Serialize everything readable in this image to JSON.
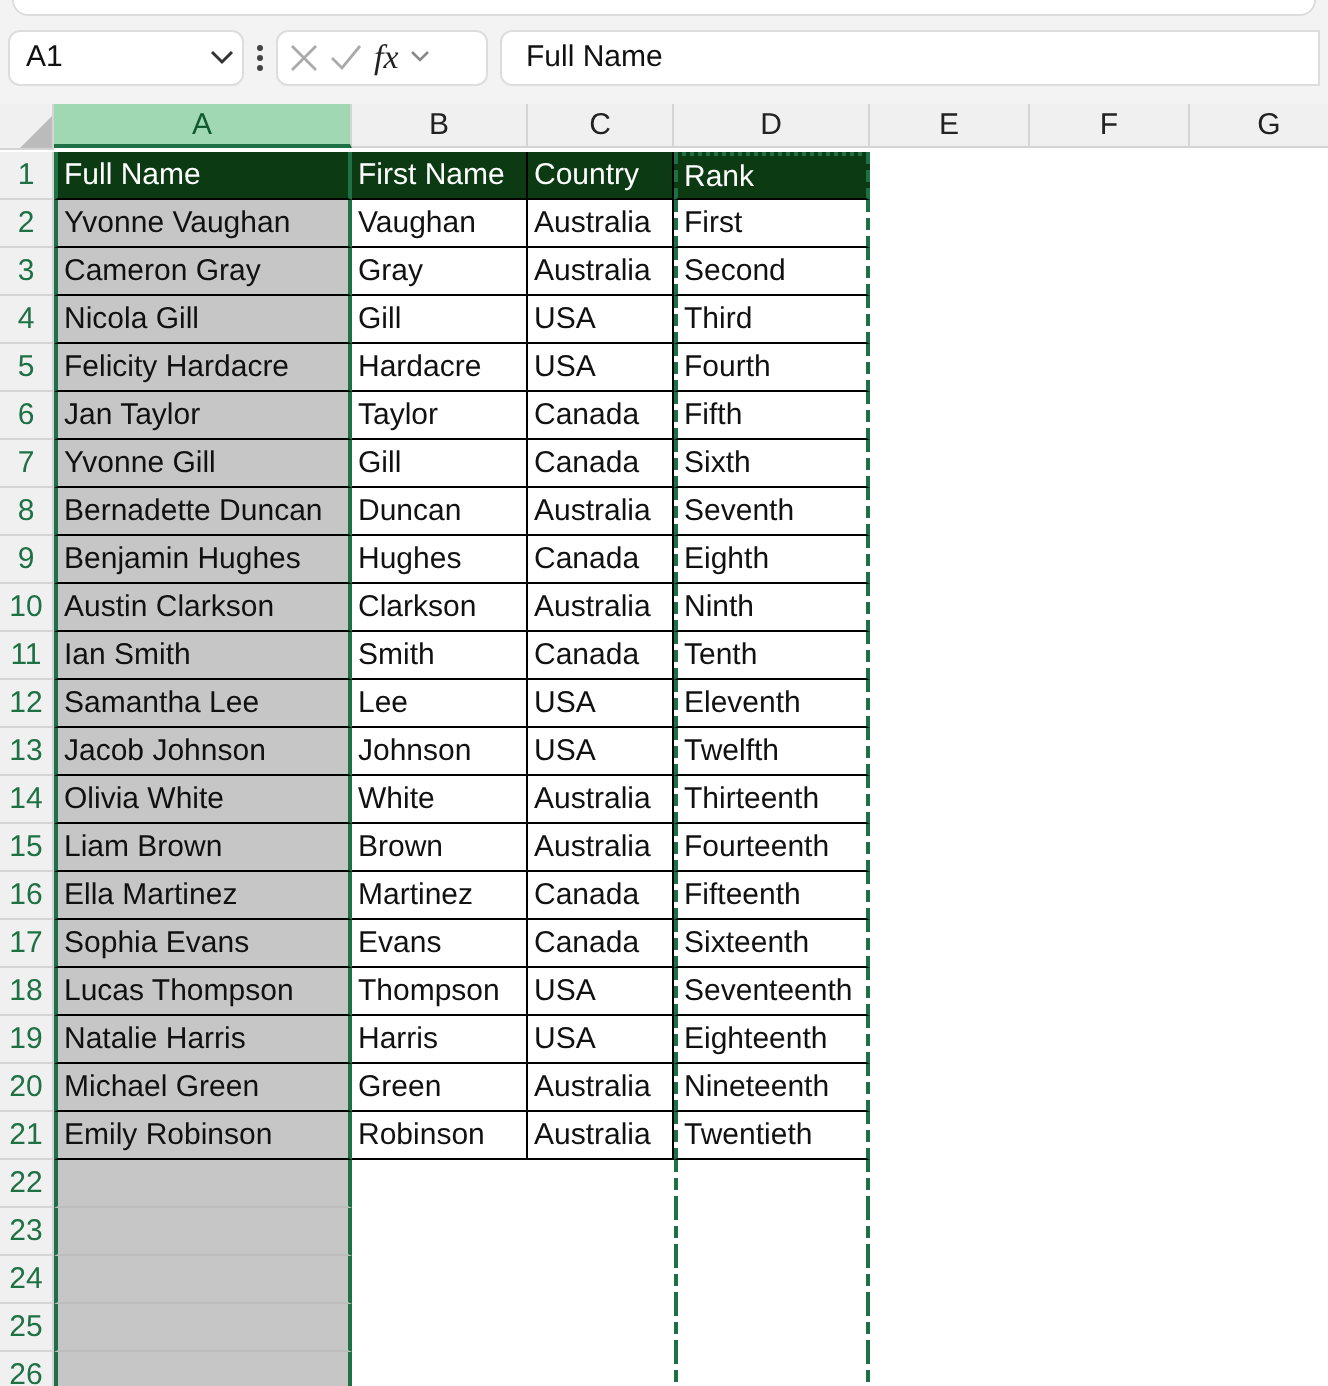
{
  "formula_bar": {
    "name_box": "A1",
    "function_label": "fx",
    "value": "Full Name"
  },
  "columns": [
    {
      "label": "A",
      "selected": true,
      "copied": false
    },
    {
      "label": "B",
      "selected": false,
      "copied": false
    },
    {
      "label": "C",
      "selected": false,
      "copied": false
    },
    {
      "label": "D",
      "selected": false,
      "copied": true
    },
    {
      "label": "E",
      "selected": false,
      "copied": false
    },
    {
      "label": "F",
      "selected": false,
      "copied": false
    },
    {
      "label": "G",
      "selected": false,
      "copied": false
    }
  ],
  "row_headers": [
    "1",
    "2",
    "3",
    "4",
    "5",
    "6",
    "7",
    "8",
    "9",
    "10",
    "11",
    "12",
    "13",
    "14",
    "15",
    "16",
    "17",
    "18",
    "19",
    "20",
    "21",
    "22",
    "23",
    "24",
    "25",
    "26"
  ],
  "header_row": [
    "Full Name",
    "First Name",
    "Country",
    "Rank"
  ],
  "rows": [
    [
      "Yvonne Vaughan",
      "Vaughan",
      "Australia",
      "First"
    ],
    [
      "Cameron Gray",
      "Gray",
      "Australia",
      "Second"
    ],
    [
      "Nicola Gill",
      "Gill",
      "USA",
      "Third"
    ],
    [
      "Felicity Hardacre",
      "Hardacre",
      "USA",
      "Fourth"
    ],
    [
      "Jan Taylor",
      "Taylor",
      "Canada",
      "Fifth"
    ],
    [
      "Yvonne Gill",
      "Gill",
      "Canada",
      "Sixth"
    ],
    [
      "Bernadette Duncan",
      "Duncan",
      "Australia",
      "Seventh"
    ],
    [
      "Benjamin Hughes",
      "Hughes",
      "Canada",
      "Eighth"
    ],
    [
      "Austin Clarkson",
      "Clarkson",
      "Australia",
      "Ninth"
    ],
    [
      "Ian Smith",
      "Smith",
      "Canada",
      "Tenth"
    ],
    [
      "Samantha Lee",
      "Lee",
      "USA",
      "Eleventh"
    ],
    [
      "Jacob Johnson",
      "Johnson",
      "USA",
      "Twelfth"
    ],
    [
      "Olivia White",
      "White",
      "Australia",
      "Thirteenth"
    ],
    [
      "Liam Brown",
      "Brown",
      "Australia",
      "Fourteenth"
    ],
    [
      "Ella Martinez",
      "Martinez",
      "Canada",
      "Fifteenth"
    ],
    [
      "Sophia Evans",
      "Evans",
      "Canada",
      "Sixteenth"
    ],
    [
      "Lucas Thompson",
      "Thompson",
      "USA",
      "Seventeenth"
    ],
    [
      "Natalie Harris",
      "Harris",
      "USA",
      "Eighteenth"
    ],
    [
      "Michael Green",
      "Green",
      "Australia",
      "Nineteenth"
    ],
    [
      "Emily Robinson",
      "Robinson",
      "Australia",
      "Twentieth"
    ]
  ]
}
